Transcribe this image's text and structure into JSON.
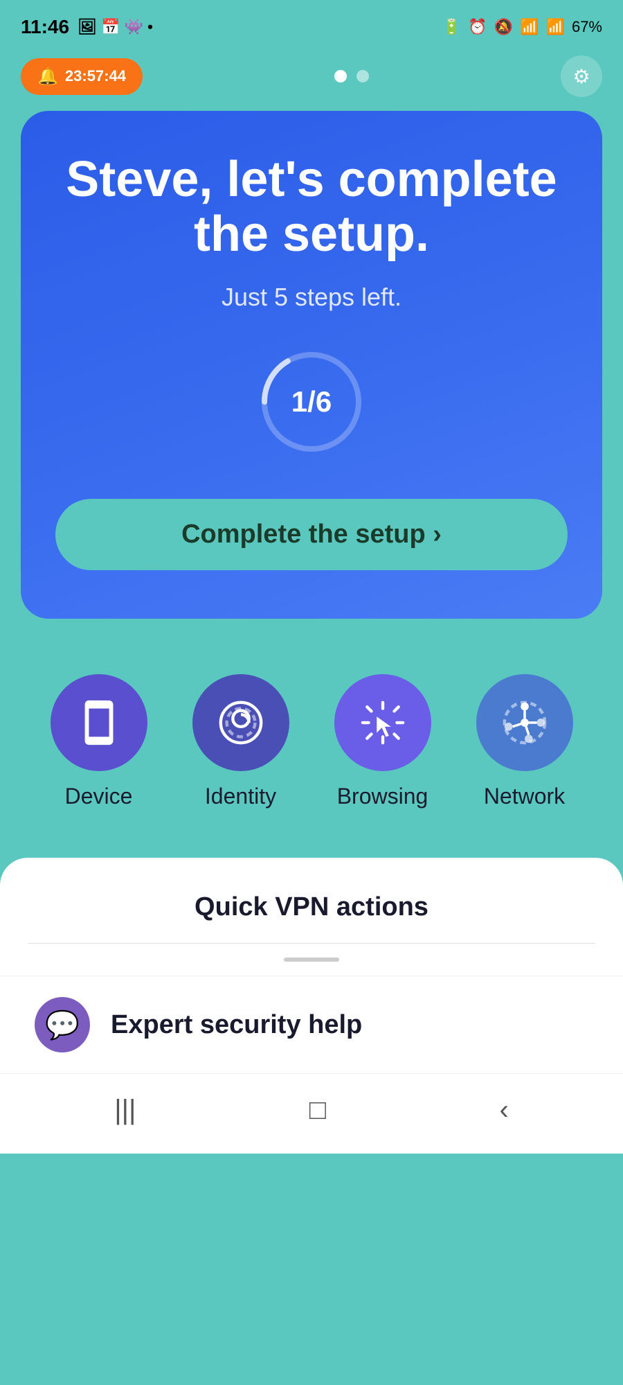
{
  "statusBar": {
    "time": "11:46",
    "batteryPercent": "67%",
    "icons": [
      "photo",
      "calendar",
      "android"
    ]
  },
  "notification": {
    "bell": "🔔",
    "timer": "23:57:44"
  },
  "pageDots": {
    "active": 0,
    "total": 2
  },
  "settings": {
    "icon": "⚙"
  },
  "card": {
    "title": "Steve, let's complete the setup.",
    "subtitle": "Just 5 steps left.",
    "progress": "1/6",
    "progressFraction": 0.1667,
    "buttonLabel": "Complete the setup ›"
  },
  "features": [
    {
      "label": "Device",
      "type": "device"
    },
    {
      "label": "Identity",
      "type": "identity"
    },
    {
      "label": "Browsing",
      "type": "browsing"
    },
    {
      "label": "Network",
      "type": "network"
    }
  ],
  "quickVPN": {
    "title": "Quick VPN actions"
  },
  "expertHelp": {
    "label": "Expert security help",
    "icon": "💬"
  },
  "bottomNav": {
    "menu": "|||",
    "home": "□",
    "back": "‹"
  }
}
